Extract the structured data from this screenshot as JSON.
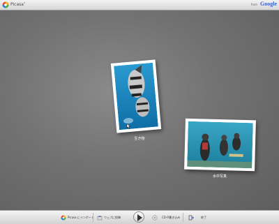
{
  "header": {
    "app_name": "Picasa",
    "app_name_suffix": "3",
    "from_label": "from",
    "brand": "Google"
  },
  "photos": [
    {
      "label": "生き物",
      "subject": "fish underwater"
    },
    {
      "label": "水中写真",
      "subject": "scuba divers underwater"
    }
  ],
  "toolbar": {
    "import_label": "Picasa にインポート",
    "web_label": "ウェブに投稿",
    "play_label": "",
    "burn_label": "CD-R書き込み",
    "exit_label": "終了"
  },
  "colors": {
    "background": "#6b6b6b",
    "water": "#1f8cc0",
    "brand_blue": "#3a62c8"
  }
}
